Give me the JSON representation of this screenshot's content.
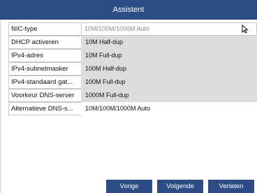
{
  "dialog": {
    "title": "Assistent"
  },
  "fields": [
    {
      "label": "NIC-type",
      "value": "10M/100M/1000M Auto"
    },
    {
      "label": "DHCP activeren",
      "value": ""
    },
    {
      "label": "IPv4-adres",
      "value": ""
    },
    {
      "label": "IPv4-subnetmasker",
      "value": ""
    },
    {
      "label": "IPv4-standaard gat...",
      "value": ""
    },
    {
      "label": "Voorkeur DNS-server",
      "value": ""
    },
    {
      "label": "Alternatieve DNS-s...",
      "value": ""
    }
  ],
  "nic_dropdown": {
    "options": [
      "10M Half-dup",
      "10M Full-dup",
      "100M Half-dup",
      "100M Full-dup",
      "1000M Full-dup",
      "10M/100M/1000M Auto"
    ]
  },
  "buttons": {
    "back": "Vorige",
    "next": "Volgende",
    "exit": "Verlaten"
  },
  "colors": {
    "accent": "#2c4d86",
    "dropdown_bg": "#dcdcdc",
    "border": "#c8c8c8"
  },
  "icons": {
    "cursor": "mouse-pointer-icon"
  }
}
